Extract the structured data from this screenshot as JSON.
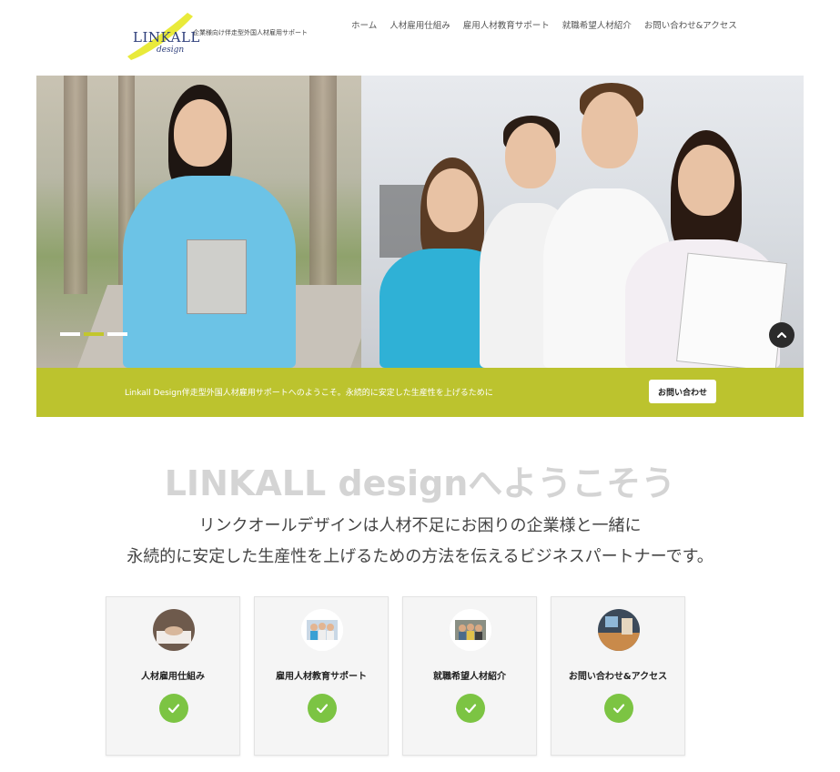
{
  "header": {
    "logo_text": "LINKALL",
    "logo_sub": "design",
    "tagline": "企業様向け伴走型外国人材雇用サポート",
    "nav": [
      "ホーム",
      "人材雇用仕組み",
      "雇用人材教育サポート",
      "就職希望人材紹介",
      "お問い合わせ&アクセス"
    ]
  },
  "hero": {
    "slides": 3,
    "active_slide": 2
  },
  "banner": {
    "text": "Linkall Design伴走型外国人材雇用サポートへのようこそ。永続的に安定した生産性を上げるために",
    "button": "お問い合わせ"
  },
  "welcome": {
    "title": "LINKALL designへようこそう",
    "line1": "リンクオールデザインは人材不足にお困りの企業様と一緒に",
    "line2": "永続的に安定した生産性を上げるための方法を伝えるビジネスパートナーです。"
  },
  "cards": [
    {
      "title": "人材雇用仕組み",
      "icon": "handshake-photo"
    },
    {
      "title": "雇用人材教育サポート",
      "icon": "team-photo"
    },
    {
      "title": "就職希望人材紹介",
      "icon": "group-photo"
    },
    {
      "title": "お問い合わせ&アクセス",
      "icon": "office-photo"
    }
  ],
  "colors": {
    "accent": "#bcc32e",
    "check": "#7cc443",
    "title_gray": "#d4d4d4"
  }
}
